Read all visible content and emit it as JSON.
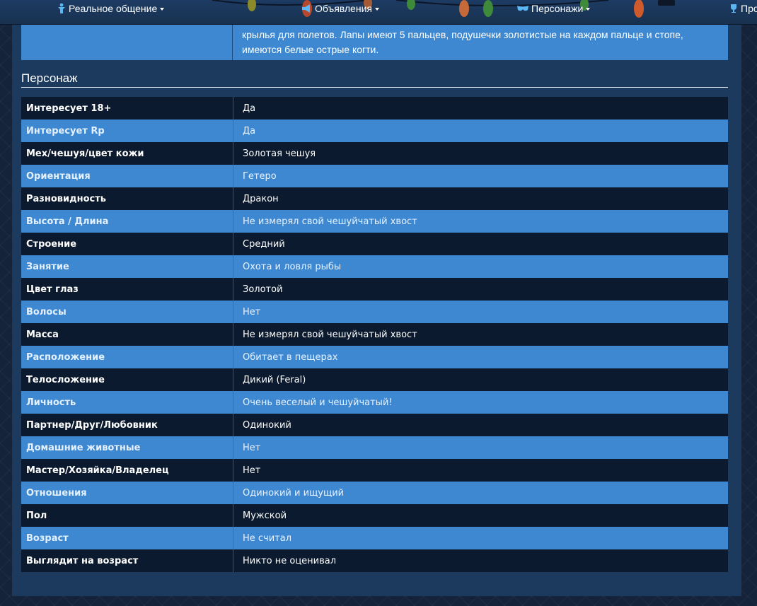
{
  "nav": {
    "items": [
      {
        "label": "Реальное общение",
        "icon": "person-icon"
      },
      {
        "label": "Объявления",
        "icon": "megaphone-icon"
      },
      {
        "label": "Персонажи",
        "icon": "mask-icon"
      },
      {
        "label": "Про",
        "icon": "trophy-icon"
      }
    ]
  },
  "description_tail": "крылья для полетов. Лапы имеют 5 пальцев, подушечки золотистые на каждом пальце и стопе, имеются белые острые когти.",
  "section": {
    "title": "Персонаж",
    "rows": [
      {
        "key": "Интересует 18+",
        "value": "Да"
      },
      {
        "key": "Интересует Rp",
        "value": "Да"
      },
      {
        "key": "Мех/чешуя/цвет кожи",
        "value": "Золотая чешуя"
      },
      {
        "key": "Ориентация",
        "value": "Гетеро"
      },
      {
        "key": "Разновидность",
        "value": "Дракон"
      },
      {
        "key": "Высота / Длина",
        "value": "Не измерял свой чешуйчатый хвост"
      },
      {
        "key": "Строение",
        "value": "Средний"
      },
      {
        "key": "Занятие",
        "value": "Охота и ловля рыбы"
      },
      {
        "key": "Цвет глаз",
        "value": "Золотой"
      },
      {
        "key": "Волосы",
        "value": "Нет"
      },
      {
        "key": "Масса",
        "value": "Не измерял свой чешуйчатый хвост"
      },
      {
        "key": "Расположение",
        "value": "Обитает в пещерах"
      },
      {
        "key": "Телосложение",
        "value": "Дикий (Feral)"
      },
      {
        "key": "Личность",
        "value": "Очень веселый и чешуйчатый!"
      },
      {
        "key": "Партнер/Друг/Любовник",
        "value": "Одинокий"
      },
      {
        "key": "Домашние животные",
        "value": "Нет"
      },
      {
        "key": "Мастер/Хозяйка/Владелец",
        "value": "Нет"
      },
      {
        "key": "Отношения",
        "value": "Одинокий и ищущий"
      },
      {
        "key": "Пол",
        "value": "Мужской"
      },
      {
        "key": "Возраст",
        "value": "Не считал"
      },
      {
        "key": "Выглядит на возраст",
        "value": "Никто не оценивал"
      }
    ]
  },
  "colors": {
    "row_dark": "#0b1a2e",
    "row_blue": "#3e88d1",
    "panel": "#1c3a5e",
    "navbar": "#1d3b63"
  }
}
